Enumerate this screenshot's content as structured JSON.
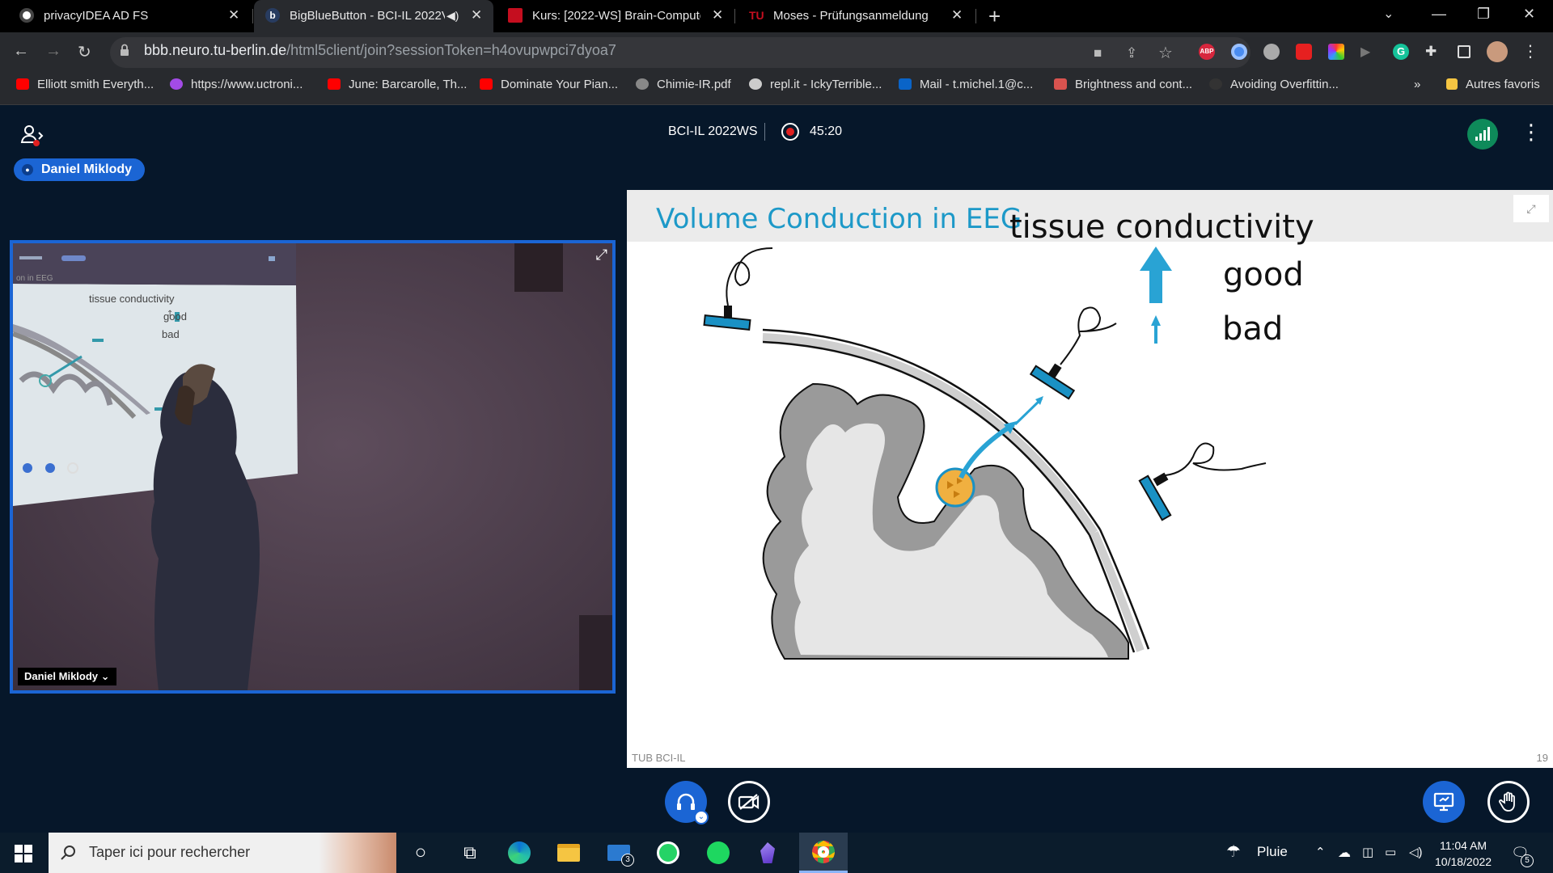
{
  "browser": {
    "tabs": [
      {
        "title": "privacyIDEA AD FS",
        "favicon": "privacyidea-icon"
      },
      {
        "title": "BigBlueButton - BCI-IL 2022V",
        "favicon": "bigbluebutton-icon",
        "audio": "speaker-muted-icon"
      },
      {
        "title": "Kurs: [2022-WS] Brain-Computer",
        "favicon": "isis-icon"
      },
      {
        "title": "Moses - Prüfungsanmeldung",
        "favicon": "moses-icon"
      }
    ],
    "url_host": "bbb.neuro.tu-berlin.de",
    "url_path": "/html5client/join?sessionToken=h4ovupwpci7dyoa7",
    "bookmarks": [
      {
        "label": "Elliott smith Everyth...",
        "icon": "youtube-icon"
      },
      {
        "label": "https://www.uctroni...",
        "icon": "messenger-icon"
      },
      {
        "label": "June: Barcarolle, Th...",
        "icon": "youtube-icon"
      },
      {
        "label": "Dominate Your Pian...",
        "icon": "youtube-icon"
      },
      {
        "label": "Chimie-IR.pdf",
        "icon": "globe-icon"
      },
      {
        "label": "repl.it - IckyTerrible...",
        "icon": "replit-icon"
      },
      {
        "label": "Mail - t.michel.1@c...",
        "icon": "outlook-icon"
      },
      {
        "label": "Brightness and cont...",
        "icon": "bookmark-icon"
      },
      {
        "label": "Avoiding Overfittin...",
        "icon": "github-icon"
      }
    ],
    "bookmarks_more": "»",
    "other_bookmarks": "Autres favoris"
  },
  "meeting": {
    "name": "BCI-IL 2022WS",
    "timer": "45:20",
    "talker": "Daniel Miklody"
  },
  "webcam": {
    "name": "Daniel Miklody",
    "mini_slide": {
      "title": "on in EEG",
      "heading": "tissue conductivity",
      "good": "good",
      "bad": "bad"
    }
  },
  "slide": {
    "title": "Volume Conduction in EEG",
    "heading": "tissue conductivity",
    "legend_good": "good",
    "legend_bad": "bad",
    "footer": "TUB BCI-IL",
    "page": "19",
    "colors": {
      "accent": "#1d99c8",
      "sensor": "#1a91c4",
      "arrow": "#29a3d4",
      "gray_matter": "#9a9a9a",
      "white_matter": "#e6e6e6"
    }
  },
  "taskbar": {
    "search_placeholder": "Taper ici pour rechercher",
    "weather": "Pluie",
    "time": "11:04 AM",
    "date": "10/18/2022",
    "mail_badge": "3",
    "notif_badge": "5"
  }
}
